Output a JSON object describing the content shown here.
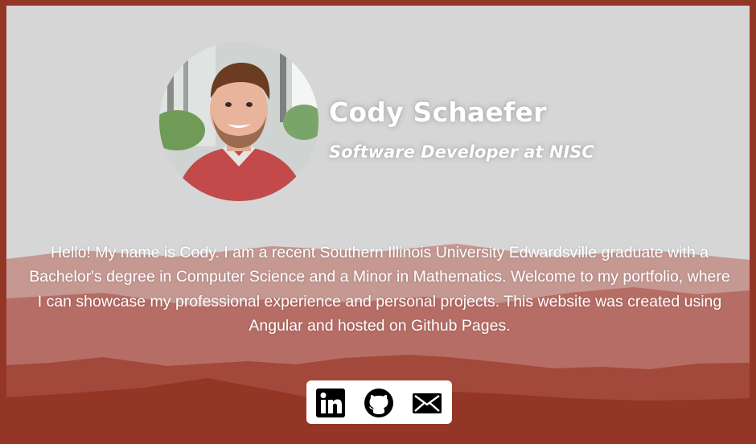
{
  "profile": {
    "name": "Cody Schaefer",
    "title": "Software Developer at NISC",
    "bio": "Hello! My name is Cody. I am a recent Southern Illinois University Edwardsville graduate with a Bachelor's degree in Computer Science and a Minor in Mathematics. Welcome to my portfolio, where I can showcase my professional experience and personal projects. This website was created using Angular and hosted on Github Pages."
  },
  "social": [
    {
      "icon": "linkedin-icon"
    },
    {
      "icon": "github-icon"
    },
    {
      "icon": "email-icon"
    }
  ],
  "colors": {
    "frame": "#943626",
    "background": "#d6d6d6",
    "mountain_light": "#c59892",
    "mountain_mid": "#b66d65",
    "mountain_dark": "#a2493c",
    "text": "#ffffff"
  }
}
